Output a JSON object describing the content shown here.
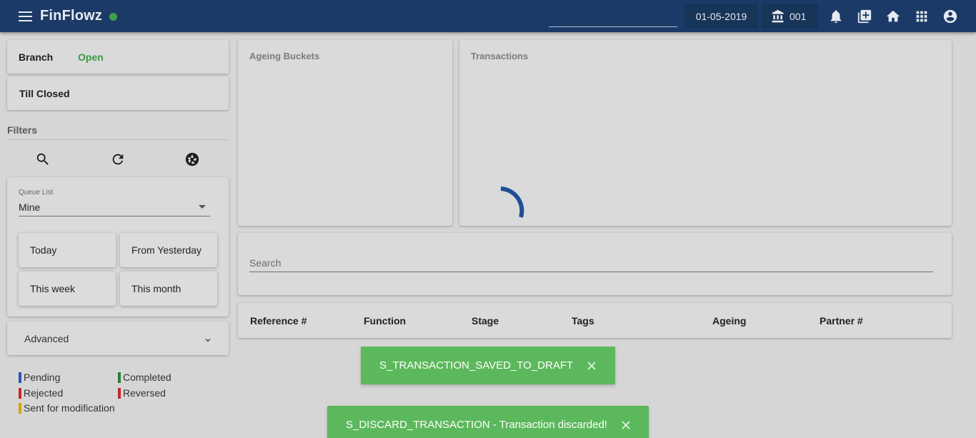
{
  "header": {
    "app_name": "FinFlowz",
    "date": "01-05-2019",
    "branch_code": "001",
    "status_color": "#3ea24b",
    "icons": [
      "menu-icon",
      "bank-icon",
      "bell-icon",
      "add-box-icon",
      "home-icon",
      "apps-grid-icon",
      "account-circle-icon"
    ]
  },
  "sidebar": {
    "branch_label": "Branch",
    "branch_status": "Open",
    "till_label": "Till Closed",
    "filters_title": "Filters",
    "tools": [
      "search-icon",
      "refresh-icon",
      "aperture-icon"
    ],
    "queue_label": "Queue List",
    "queue_value": "Mine",
    "quick_filters": [
      "Today",
      "From Yesterday",
      "This week",
      "This month"
    ],
    "advanced_label": "Advanced"
  },
  "legend": [
    {
      "label": "Pending",
      "color": "#2d55b5"
    },
    {
      "label": "Completed",
      "color": "#2e7d32"
    },
    {
      "label": "Rejected",
      "color": "#c62828"
    },
    {
      "label": "Reversed",
      "color": "#c62828"
    },
    {
      "label": "Sent for modification",
      "color": "#d6a400"
    }
  ],
  "panels": {
    "ageing_title": "Ageing Buckets",
    "transactions_title": "Transactions"
  },
  "search": {
    "placeholder": "Search"
  },
  "table": {
    "columns": [
      "Reference #",
      "Function",
      "Stage",
      "Tags",
      "Ageing",
      "Partner #"
    ]
  },
  "toasts": [
    {
      "message": "S_TRANSACTION_SAVED_TO_DRAFT"
    },
    {
      "message": "S_DISCARD_TRANSACTION - Transaction discarded!"
    }
  ],
  "colors": {
    "header_bg": "#1b3a68",
    "spinner": "#1f4f94",
    "toast_bg": "#5cb85c",
    "open_status": "#3a9a47"
  }
}
